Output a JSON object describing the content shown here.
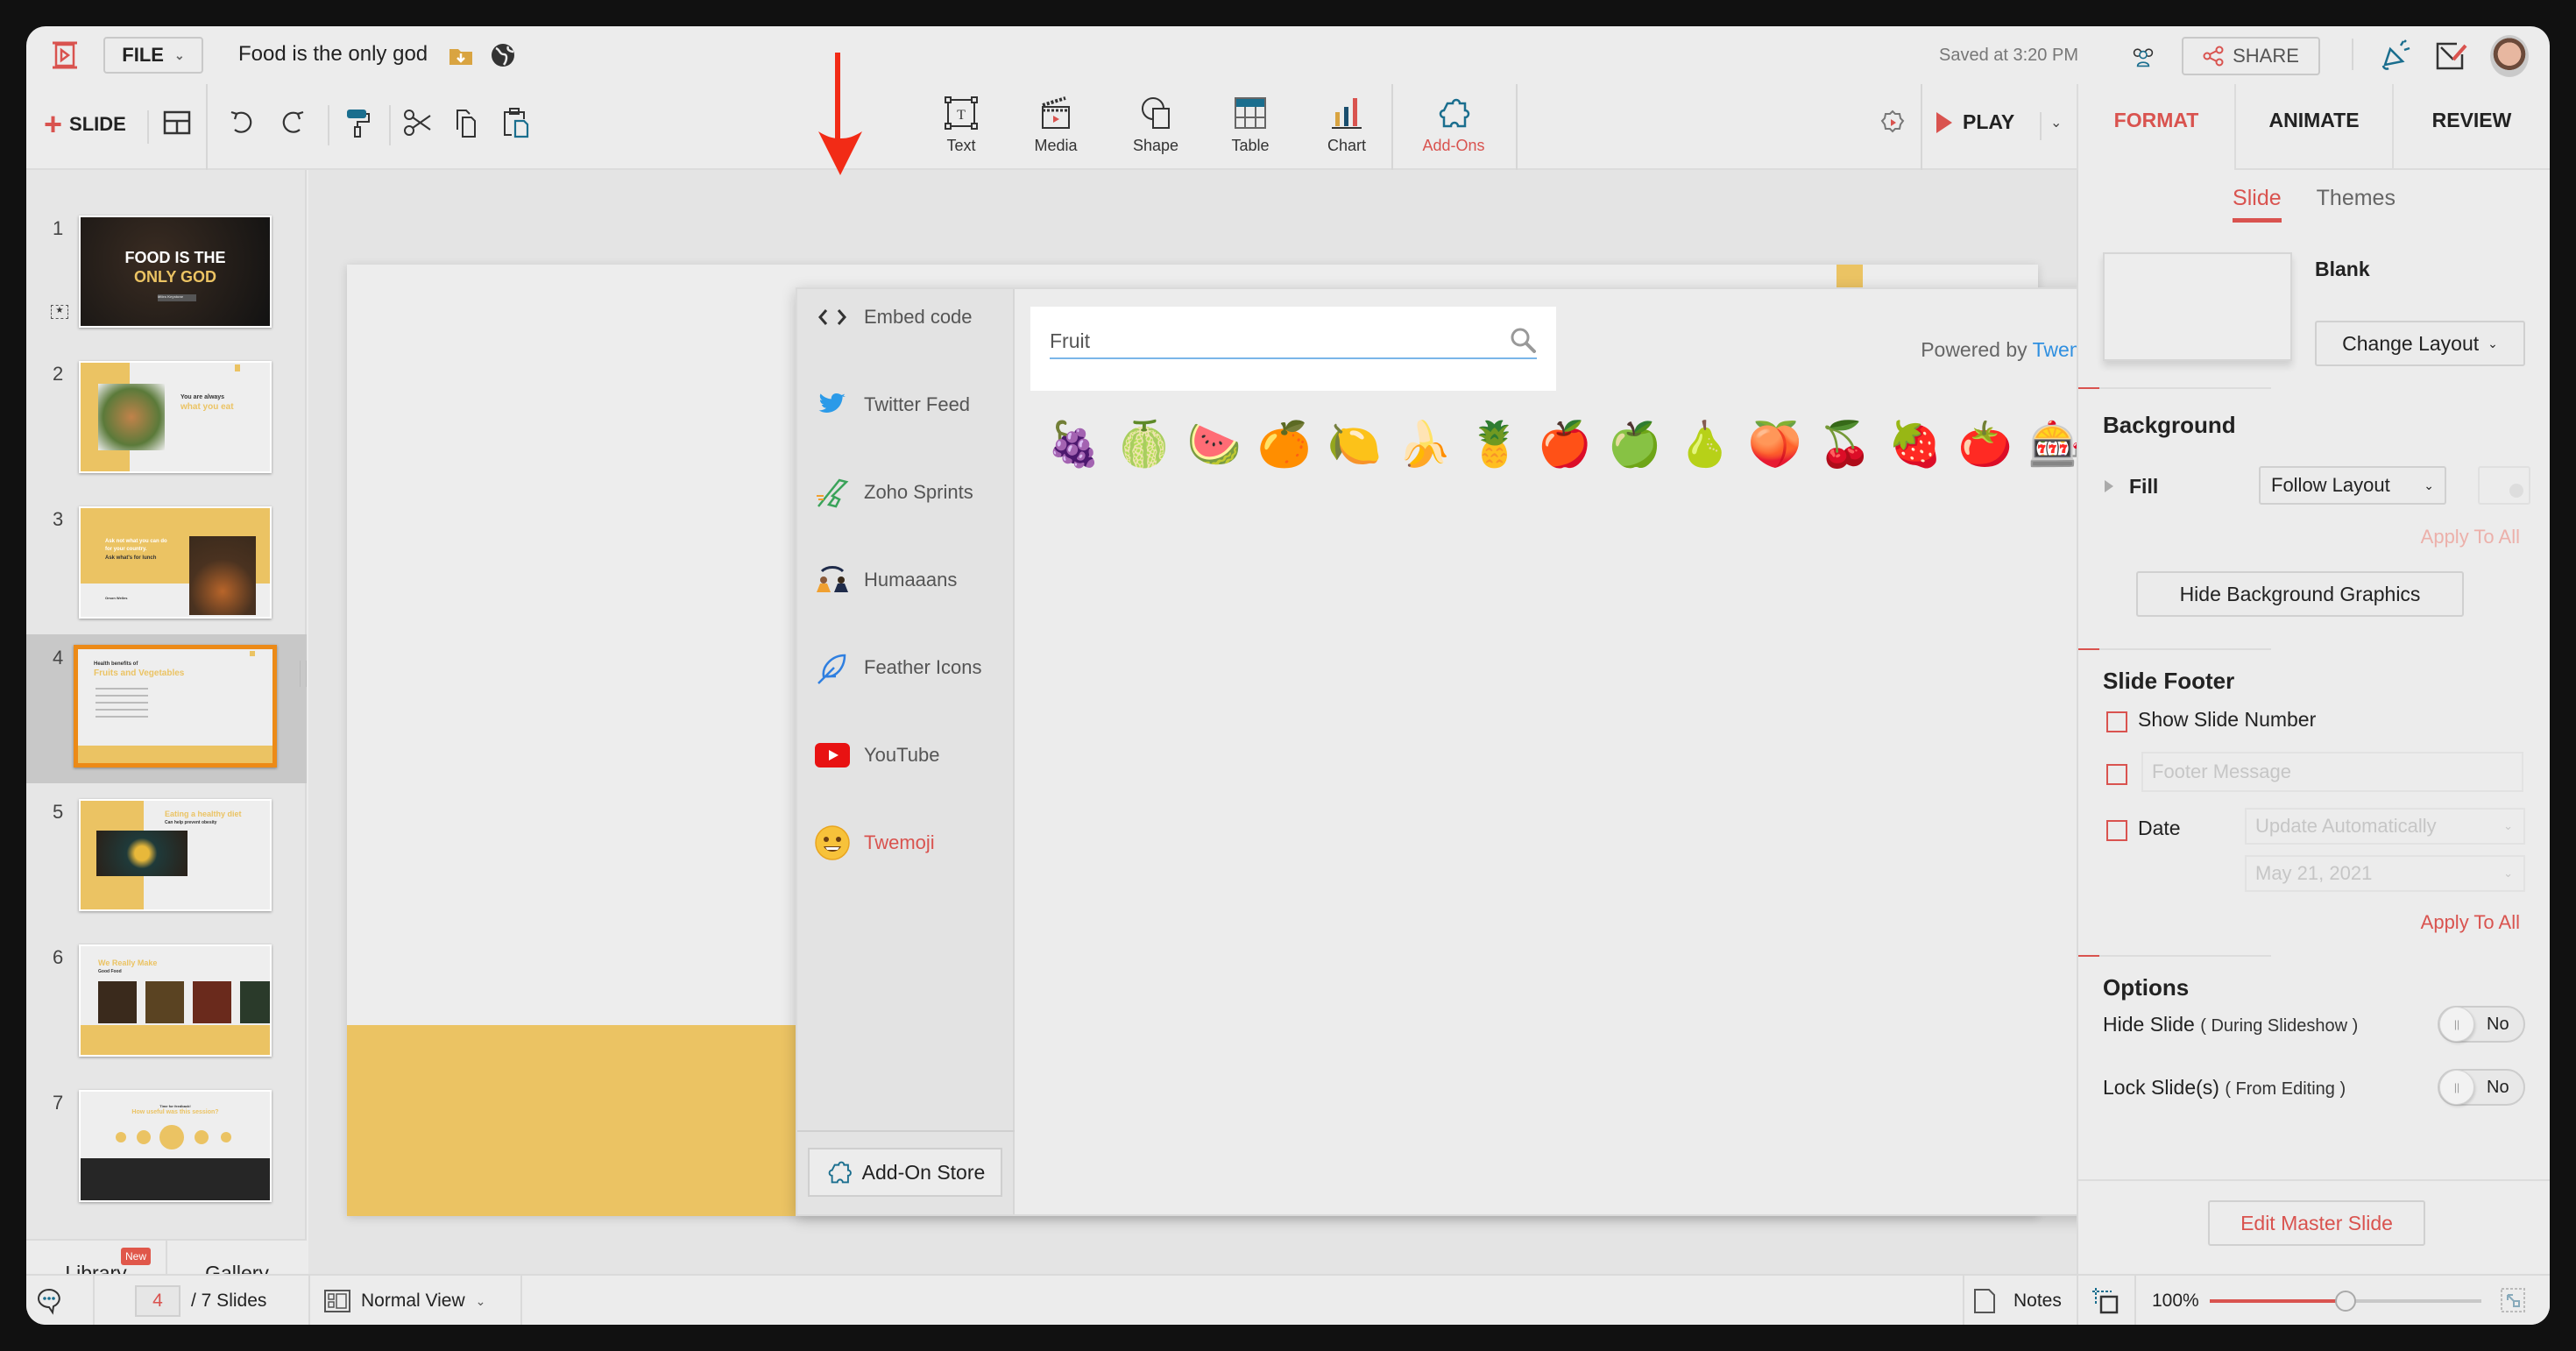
{
  "header": {
    "file_label": "FILE",
    "doc_title": "Food is the only god",
    "saved_status": "Saved at 3:20 PM",
    "share_label": "SHARE"
  },
  "toolbar": {
    "add_slide_label": "SLIDE",
    "insert": [
      {
        "label": "Text",
        "icon": "text-box-icon"
      },
      {
        "label": "Media",
        "icon": "clapperboard-icon"
      },
      {
        "label": "Shape",
        "icon": "shape-icon"
      },
      {
        "label": "Table",
        "icon": "table-icon"
      },
      {
        "label": "Chart",
        "icon": "bar-chart-icon"
      },
      {
        "label": "Add-Ons",
        "icon": "puzzle-icon",
        "active": true
      }
    ],
    "play_label": "PLAY"
  },
  "right_tabs": [
    {
      "label": "FORMAT",
      "active": true
    },
    {
      "label": "ANIMATE"
    },
    {
      "label": "REVIEW"
    }
  ],
  "slides": {
    "current": 4,
    "total_label": "/ 7 Slides",
    "items": [
      {
        "num": "1",
        "title": "FOOD IS THE",
        "title2": "ONLY GOD",
        "sub": "Miles Keystone"
      },
      {
        "num": "2",
        "title": "You are always",
        "title2": "what you eat"
      },
      {
        "num": "3",
        "title": "Ask not what you can do for your country.",
        "title2": "Ask what's for lunch",
        "sub": "Orson Welles"
      },
      {
        "num": "4",
        "title": "Health benefits of",
        "title2": "Fruits and Vegetables",
        "selected": true
      },
      {
        "num": "5",
        "title": "Eating a healthy diet",
        "title2": "Can help prevent obesity"
      },
      {
        "num": "6",
        "title": "We Really Make",
        "title2": "Good Food"
      },
      {
        "num": "7",
        "title": "Time for feedback!",
        "title2": "How useful was this session?"
      }
    ]
  },
  "left_bottom": {
    "library_label": "Library",
    "new_badge": "New",
    "gallery_label": "Gallery"
  },
  "addon_dialog": {
    "nav": [
      {
        "label": "Embed code",
        "icon": "code-brackets-icon"
      },
      {
        "label": "Twitter Feed",
        "icon": "twitter-icon"
      },
      {
        "label": "Zoho Sprints",
        "icon": "zoho-sprints-icon"
      },
      {
        "label": "Humaaans",
        "icon": "humaaans-icon"
      },
      {
        "label": "Feather Icons",
        "icon": "feather-icon"
      },
      {
        "label": "YouTube",
        "icon": "youtube-icon"
      },
      {
        "label": "Twemoji",
        "icon": "smiley-icon",
        "active": true
      }
    ],
    "store_label": "Add-On Store",
    "search_value": "Fruit",
    "powered_prefix": "Powered by",
    "powered_link": "Twemoji",
    "results": [
      {
        "name": "grapes",
        "glyph": "🍇"
      },
      {
        "name": "melon",
        "glyph": "🍈"
      },
      {
        "name": "watermelon",
        "glyph": "🍉"
      },
      {
        "name": "tangerine",
        "glyph": "🍊"
      },
      {
        "name": "lemon",
        "glyph": "🍋"
      },
      {
        "name": "banana",
        "glyph": "🍌"
      },
      {
        "name": "pineapple",
        "glyph": "🍍"
      },
      {
        "name": "red-apple",
        "glyph": "🍎"
      },
      {
        "name": "green-apple",
        "glyph": "🍏"
      },
      {
        "name": "pear",
        "glyph": "🍐"
      },
      {
        "name": "peach",
        "glyph": "🍑"
      },
      {
        "name": "cherries",
        "glyph": "🍒"
      },
      {
        "name": "strawberry",
        "glyph": "🍓"
      },
      {
        "name": "tomato",
        "glyph": "🍅"
      },
      {
        "name": "slot-machine",
        "glyph": "🎰"
      }
    ]
  },
  "format_panel": {
    "subtabs": [
      {
        "label": "Slide",
        "active": true
      },
      {
        "label": "Themes"
      }
    ],
    "layout_name": "Blank",
    "change_layout_label": "Change Layout",
    "background_heading": "Background",
    "fill_label": "Fill",
    "fill_value": "Follow Layout",
    "apply_all_label": "Apply To All",
    "hide_bg_label": "Hide Background Graphics",
    "footer_heading": "Slide Footer",
    "show_slide_number_label": "Show Slide Number",
    "footer_message_placeholder": "Footer Message",
    "date_label": "Date",
    "date_mode_value": "Update Automatically",
    "date_value": "May 21, 2021",
    "footer_apply_all_label": "Apply To All",
    "options_heading": "Options",
    "hide_slide_label": "Hide Slide",
    "hide_slide_note": "( During Slideshow )",
    "hide_slide_value": "No",
    "lock_slide_label": "Lock Slide(s)",
    "lock_slide_note": "( From Editing )",
    "lock_slide_value": "No",
    "edit_master_label": "Edit Master Slide"
  },
  "status_bar": {
    "current_page": "4",
    "total_label": "/ 7 Slides",
    "view_label": "Normal View",
    "notes_label": "Notes",
    "zoom_label": "100%",
    "zoom_slider_fraction": 0.5
  },
  "colors": {
    "accent": "#d9534f",
    "selection": "#ec8a17",
    "slide_yellow": "#ebc363",
    "link_blue": "#2f8fe0"
  }
}
